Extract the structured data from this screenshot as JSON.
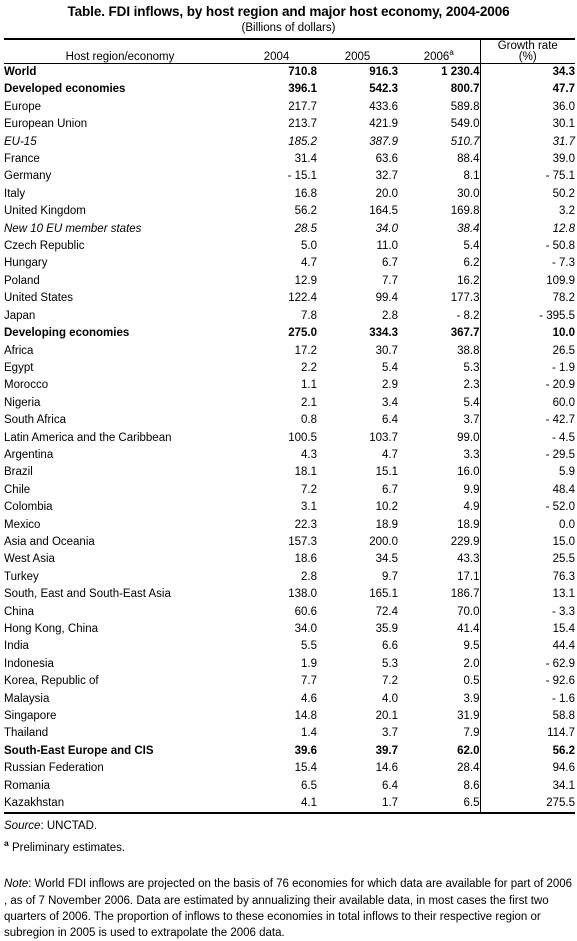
{
  "title": {
    "main": "Table.  FDI inflows, by host region and major host economy, 2004-2006",
    "subtitle": "(Billions of dollars)"
  },
  "header": {
    "name": "Host region/economy",
    "year_2004": "2004",
    "year_2005": "2005",
    "year_2006": "2006",
    "year_2006_sup": "a",
    "growth_line1": "Growth rate",
    "growth_line2": "(%)"
  },
  "chart_data": {
    "type": "table",
    "title": "Table.  FDI inflows, by host region and major host economy, 2004-2006",
    "subtitle": "(Billions of dollars)",
    "columns": [
      "Host region/economy",
      "2004",
      "2005",
      "2006 a",
      "Growth rate (%)"
    ],
    "rows": [
      {
        "name": "World",
        "level": 0,
        "style": "bold",
        "v2004": "710.8",
        "v2005": "916.3",
        "v2006": "1 230.4",
        "growth": "34.3"
      },
      {
        "name": "Developed economies",
        "level": 1,
        "style": "bold",
        "v2004": "396.1",
        "v2005": "542.3",
        "v2006": "800.7",
        "growth": "47.7"
      },
      {
        "name": "Europe",
        "level": 2,
        "style": "normal",
        "v2004": "217.7",
        "v2005": "433.6",
        "v2006": "589.8",
        "growth": "36.0"
      },
      {
        "name": "European Union",
        "level": 3,
        "style": "normal",
        "v2004": "213.7",
        "v2005": "421.9",
        "v2006": "549.0",
        "growth": "30.1"
      },
      {
        "name": "EU-15",
        "level": 4,
        "style": "italic",
        "v2004": "185.2",
        "v2005": "387.9",
        "v2006": "510.7",
        "growth": "31.7"
      },
      {
        "name": "France",
        "level": 5,
        "style": "normal",
        "v2004": "31.4",
        "v2005": "63.6",
        "v2006": "88.4",
        "growth": "39.0"
      },
      {
        "name": "Germany",
        "level": 5,
        "style": "normal",
        "v2004": "- 15.1",
        "v2005": "32.7",
        "v2006": "8.1",
        "growth": "- 75.1"
      },
      {
        "name": "Italy",
        "level": 5,
        "style": "normal",
        "v2004": "16.8",
        "v2005": "20.0",
        "v2006": "30.0",
        "growth": "50.2"
      },
      {
        "name": "United Kingdom",
        "level": 5,
        "style": "normal",
        "v2004": "56.2",
        "v2005": "164.5",
        "v2006": "169.8",
        "growth": "3.2"
      },
      {
        "name": "New 10 EU member states",
        "level": 4,
        "style": "italic",
        "v2004": "28.5",
        "v2005": "34.0",
        "v2006": "38.4",
        "growth": "12.8"
      },
      {
        "name": "Czech Republic",
        "level": 5,
        "style": "normal",
        "v2004": "5.0",
        "v2005": "11.0",
        "v2006": "5.4",
        "growth": "- 50.8"
      },
      {
        "name": "Hungary",
        "level": 5,
        "style": "normal",
        "v2004": "4.7",
        "v2005": "6.7",
        "v2006": "6.2",
        "growth": "- 7.3"
      },
      {
        "name": "Poland",
        "level": 5,
        "style": "normal",
        "v2004": "12.9",
        "v2005": "7.7",
        "v2006": "16.2",
        "growth": "109.9"
      },
      {
        "name": "United States",
        "level": 2,
        "style": "normal",
        "v2004": "122.4",
        "v2005": "99.4",
        "v2006": "177.3",
        "growth": "78.2"
      },
      {
        "name": "Japan",
        "level": 2,
        "style": "normal",
        "v2004": "7.8",
        "v2005": "2.8",
        "v2006": "- 8.2",
        "growth": "- 395.5"
      },
      {
        "name": "Developing economies",
        "level": 1,
        "style": "bold",
        "v2004": "275.0",
        "v2005": "334.3",
        "v2006": "367.7",
        "growth": "10.0"
      },
      {
        "name": "Africa",
        "level": 2,
        "style": "normal",
        "v2004": "17.2",
        "v2005": "30.7",
        "v2006": "38.8",
        "growth": "26.5"
      },
      {
        "name": "Egypt",
        "level": 5,
        "style": "normal",
        "v2004": "2.2",
        "v2005": "5.4",
        "v2006": "5.3",
        "growth": "- 1.9"
      },
      {
        "name": "Morocco",
        "level": 5,
        "style": "normal",
        "v2004": "1.1",
        "v2005": "2.9",
        "v2006": "2.3",
        "growth": "- 20.9"
      },
      {
        "name": "Nigeria",
        "level": 5,
        "style": "normal",
        "v2004": "2.1",
        "v2005": "3.4",
        "v2006": "5.4",
        "growth": "60.0"
      },
      {
        "name": "South Africa",
        "level": 5,
        "style": "normal",
        "v2004": "0.8",
        "v2005": "6.4",
        "v2006": "3.7",
        "growth": "- 42.7"
      },
      {
        "name": "Latin America and the Caribbean",
        "level": 2,
        "style": "normal",
        "v2004": "100.5",
        "v2005": "103.7",
        "v2006": "99.0",
        "growth": "- 4.5"
      },
      {
        "name": "Argentina",
        "level": 5,
        "style": "normal",
        "v2004": "4.3",
        "v2005": "4.7",
        "v2006": "3.3",
        "growth": "- 29.5"
      },
      {
        "name": "Brazil",
        "level": 5,
        "style": "normal",
        "v2004": "18.1",
        "v2005": "15.1",
        "v2006": "16.0",
        "growth": "5.9"
      },
      {
        "name": "Chile",
        "level": 5,
        "style": "normal",
        "v2004": "7.2",
        "v2005": "6.7",
        "v2006": "9.9",
        "growth": "48.4"
      },
      {
        "name": "Colombia",
        "level": 5,
        "style": "normal",
        "v2004": "3.1",
        "v2005": "10.2",
        "v2006": "4.9",
        "growth": "- 52.0"
      },
      {
        "name": "Mexico",
        "level": 5,
        "style": "normal",
        "v2004": "22.3",
        "v2005": "18.9",
        "v2006": "18.9",
        "growth": "0.0"
      },
      {
        "name": "Asia and Oceania",
        "level": 2,
        "style": "normal",
        "v2004": "157.3",
        "v2005": "200.0",
        "v2006": "229.9",
        "growth": "15.0"
      },
      {
        "name": "West Asia",
        "level": 3,
        "style": "normal",
        "v2004": "18.6",
        "v2005": "34.5",
        "v2006": "43.3",
        "growth": "25.5"
      },
      {
        "name": "Turkey",
        "level": 5,
        "style": "normal",
        "v2004": "2.8",
        "v2005": "9.7",
        "v2006": "17.1",
        "growth": "76.3"
      },
      {
        "name": "South, East and South-East Asia",
        "level": 3,
        "style": "normal",
        "v2004": "138.0",
        "v2005": "165.1",
        "v2006": "186.7",
        "growth": "13.1"
      },
      {
        "name": "China",
        "level": 5,
        "style": "normal",
        "v2004": "60.6",
        "v2005": "72.4",
        "v2006": "70.0",
        "growth": "- 3.3"
      },
      {
        "name": "Hong Kong, China",
        "level": 5,
        "style": "normal",
        "v2004": "34.0",
        "v2005": "35.9",
        "v2006": "41.4",
        "growth": "15.4"
      },
      {
        "name": "India",
        "level": 5,
        "style": "normal",
        "v2004": "5.5",
        "v2005": "6.6",
        "v2006": "9.5",
        "growth": "44.4"
      },
      {
        "name": "Indonesia",
        "level": 5,
        "style": "normal",
        "v2004": "1.9",
        "v2005": "5.3",
        "v2006": "2.0",
        "growth": "- 62.9"
      },
      {
        "name": "Korea, Republic of",
        "level": 5,
        "style": "normal",
        "v2004": "7.7",
        "v2005": "7.2",
        "v2006": "0.5",
        "growth": "- 92.6"
      },
      {
        "name": "Malaysia",
        "level": 5,
        "style": "normal",
        "v2004": "4.6",
        "v2005": "4.0",
        "v2006": "3.9",
        "growth": "- 1.6"
      },
      {
        "name": "Singapore",
        "level": 5,
        "style": "normal",
        "v2004": "14.8",
        "v2005": "20.1",
        "v2006": "31.9",
        "growth": "58.8"
      },
      {
        "name": "Thailand",
        "level": 5,
        "style": "normal",
        "v2004": "1.4",
        "v2005": "3.7",
        "v2006": "7.9",
        "growth": "114.7"
      },
      {
        "name": "South-East Europe and CIS",
        "level": 1,
        "style": "bold",
        "v2004": "39.6",
        "v2005": "39.7",
        "v2006": "62.0",
        "growth": "56.2"
      },
      {
        "name": "Russian Federation",
        "level": 5,
        "style": "normal",
        "v2004": "15.4",
        "v2005": "14.6",
        "v2006": "28.4",
        "growth": "94.6"
      },
      {
        "name": "Romania",
        "level": 5,
        "style": "normal",
        "v2004": "6.5",
        "v2005": "6.4",
        "v2006": "8.6",
        "growth": "34.1"
      },
      {
        "name": "Kazakhstan",
        "level": 5,
        "style": "normal",
        "v2004": "4.1",
        "v2005": "1.7",
        "v2006": "6.5",
        "growth": "275.5"
      }
    ]
  },
  "footnotes": {
    "source_label": "Source",
    "source_text": ": UNCTAD.",
    "note_a_marker": "a",
    "note_a_text": "Preliminary estimates.",
    "note_label": "Note",
    "note_text": ":  World FDI inflows are projected on the basis of 76 economies for which data are available for part of 2006 , as of 7 November 2006.  Data are estimated by annualizing their available data, in most cases the first two quarters of 2006. The proportion of inflows to these economies in total inflows to their respective region or subregion in 2005 is used to extrapolate the 2006 data."
  }
}
